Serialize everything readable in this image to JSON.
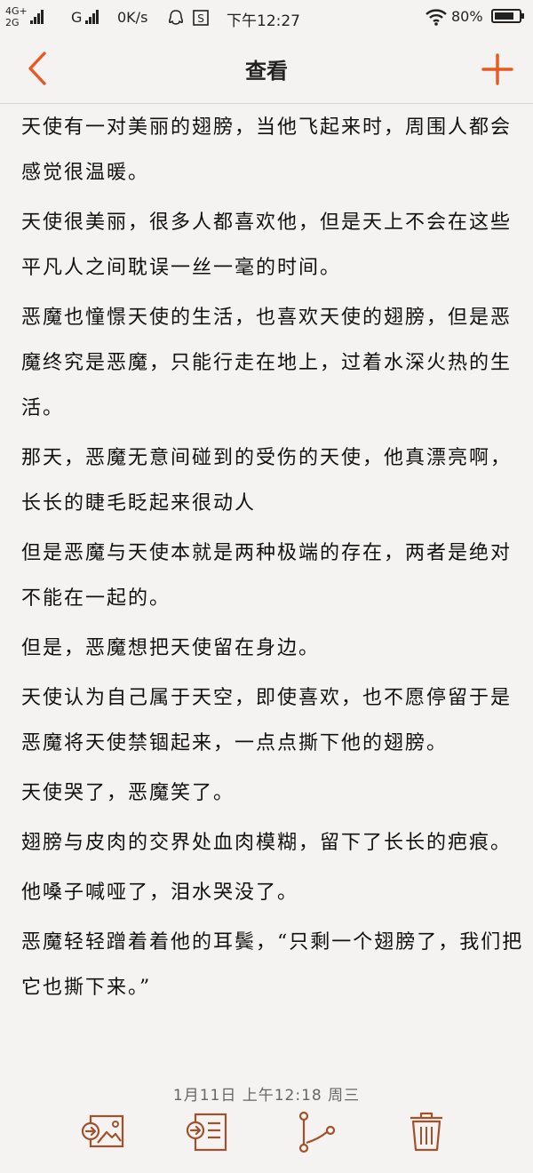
{
  "status_bar": {
    "network_top": "4G+",
    "network_bottom": "2G",
    "network_g": "G",
    "speed": "0K/s",
    "time": "下午12:27",
    "battery": "80%",
    "battery_level": 0.8
  },
  "nav": {
    "title": "查看",
    "back_icon": "chevron-left-icon",
    "add_icon": "plus-icon",
    "accent_color": "#e8581f"
  },
  "note": {
    "paragraphs": [
      "天使有一对美丽的翅膀，当他飞起来时，周围人都会感觉很温暖。",
      "天使很美丽，很多人都喜欢他，但是天上不会在这些平凡人之间耽误一丝一毫的时间。",
      "恶魔也憧憬天使的生活，也喜欢天使的翅膀，但是恶魔终究是恶魔，只能行走在地上，过着水深火热的生活。",
      "那天，恶魔无意间碰到的受伤的天使，他真漂亮啊，长长的睫毛眨起来很动人",
      "但是恶魔与天使本就是两种极端的存在，两者是绝对不能在一起的。",
      "但是，恶魔想把天使留在身边。",
      "天使认为自己属于天空，即使喜欢，也不愿停留于是恶魔将天使禁锢起来，一点点撕下他的翅膀。",
      "天使哭了，恶魔笑了。",
      "翅膀与皮肉的交界处血肉模糊，留下了长长的疤痕。",
      "他嗓子喊哑了，泪水哭没了。",
      "恶魔轻轻蹭着着他的耳鬓，“只剩一个翅膀了，我们把它也撕下来。”"
    ],
    "date": "1月11日 上午12:18 周三"
  },
  "toolbar": {
    "icons": [
      "export-image-icon",
      "export-text-icon",
      "share-icon",
      "trash-icon"
    ],
    "icon_color": "#a0522d"
  }
}
